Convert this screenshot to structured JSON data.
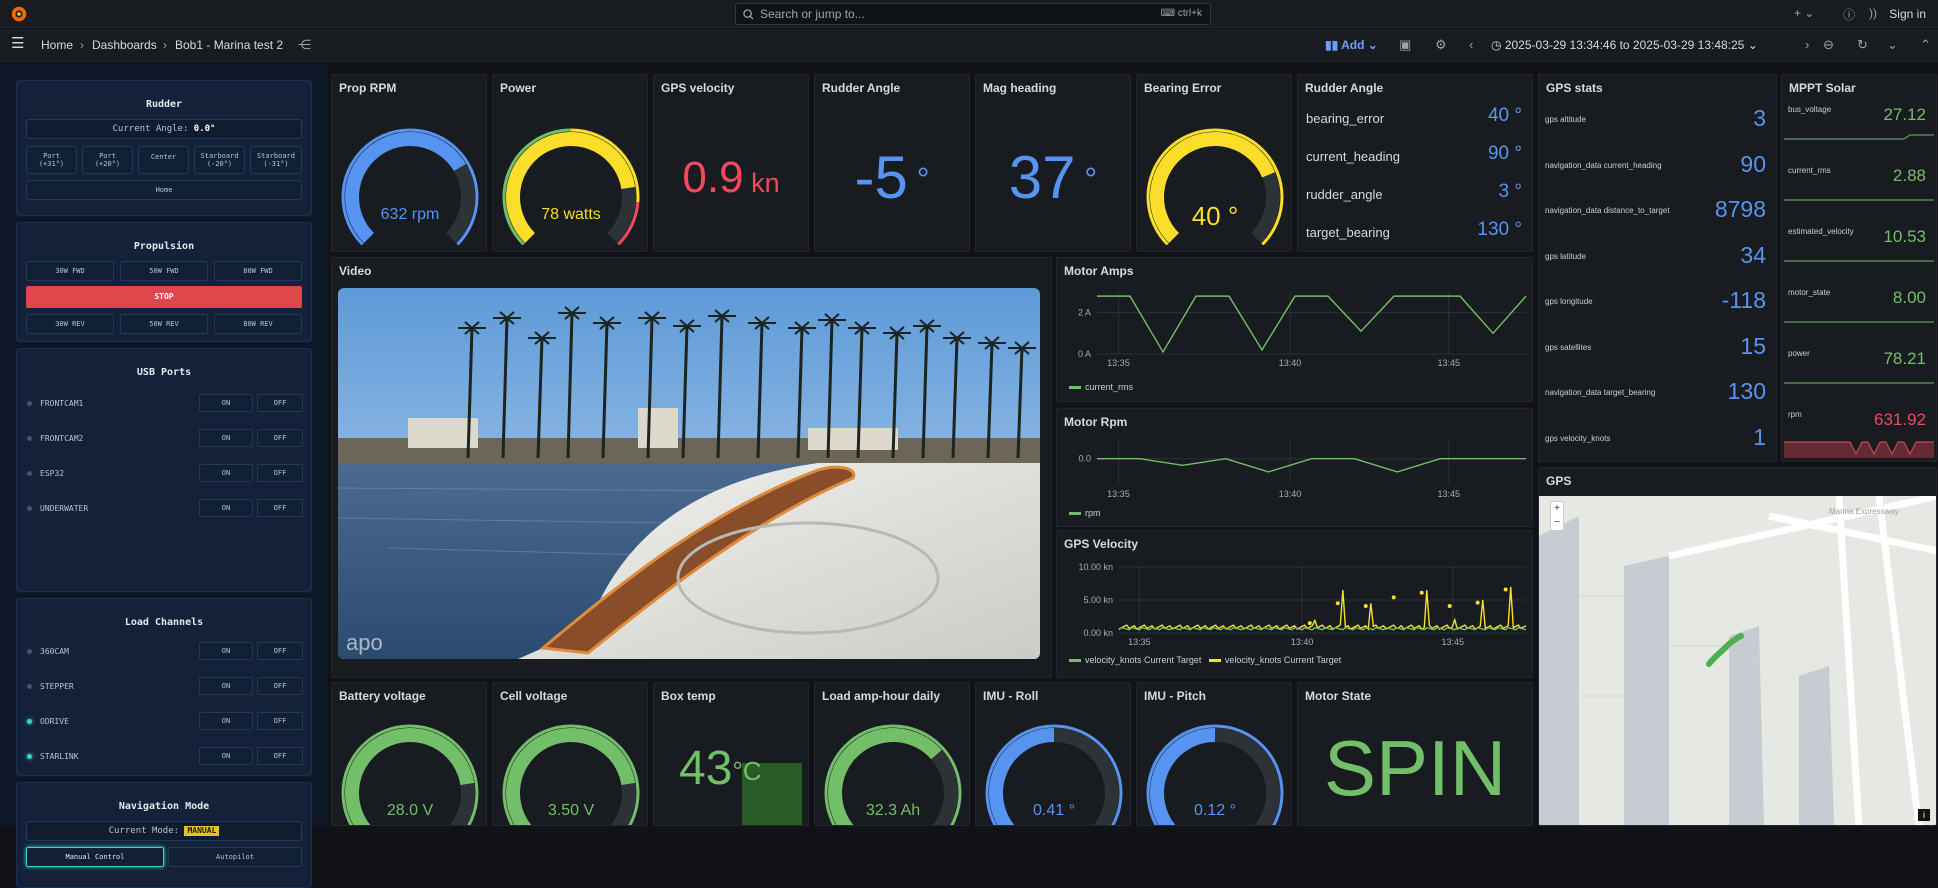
{
  "topbar": {
    "search_placeholder": "Search or jump to...",
    "search_shortcut": "ctrl+k",
    "sign_in": "Sign in"
  },
  "nav": {
    "breadcrumb": [
      "Home",
      "Dashboards",
      "Bob1 - Marina test 2"
    ],
    "add": "Add",
    "time_range": "2025-03-29 13:34:46 to 2025-03-29 13:48:25"
  },
  "sidebar": {
    "rudder": {
      "title": "Rudder",
      "angle_label": "Current Angle:",
      "angle_value": "0.0°",
      "buttons": [
        [
          "Port",
          "(+31°)"
        ],
        [
          "Port",
          "(+20°)"
        ],
        [
          "Center",
          ""
        ],
        [
          "Starboard",
          "(-20°)"
        ],
        [
          "Starboard",
          "(-31°)"
        ]
      ],
      "home": "Home"
    },
    "propulsion": {
      "title": "Propulsion",
      "fwd": [
        "30W FWD",
        "50W FWD",
        "80W FWD"
      ],
      "stop": "STOP",
      "rev": [
        "30W REV",
        "50W REV",
        "80W REV"
      ]
    },
    "usb": {
      "title": "USB Ports",
      "on": "ON",
      "off": "OFF",
      "ports": [
        {
          "name": "FRONTCAM1",
          "active": false
        },
        {
          "name": "FRONTCAM2",
          "active": false
        },
        {
          "name": "ESP32",
          "active": false
        },
        {
          "name": "UNDERWATER",
          "active": false
        }
      ]
    },
    "load": {
      "title": "Load Channels",
      "on": "ON",
      "off": "OFF",
      "channels": [
        {
          "name": "360CAM",
          "active": false
        },
        {
          "name": "STEPPER",
          "active": false
        },
        {
          "name": "ODRIVE",
          "active": true
        },
        {
          "name": "STARLINK",
          "active": true
        }
      ]
    },
    "nav_mode": {
      "title": "Navigation Mode",
      "label": "Current Mode:",
      "value": "MANUAL",
      "manual": "Manual Control",
      "auto": "Autopilot"
    }
  },
  "stats": {
    "prop_rpm": {
      "title": "Prop RPM",
      "value": "632 rpm",
      "fraction": 0.72
    },
    "power": {
      "title": "Power",
      "value": "78 watts",
      "fraction": 0.8
    },
    "gps_velocity": {
      "title": "GPS velocity",
      "value": "0.9",
      "unit": "kn"
    },
    "rudder_angle": {
      "title": "Rudder Angle",
      "value": "-5",
      "unit": "°"
    },
    "mag_heading": {
      "title": "Mag heading",
      "value": "37",
      "unit": "°"
    },
    "bearing_error": {
      "title": "Bearing Error",
      "value": "40 °",
      "fraction": 0.75
    }
  },
  "rudder_table": {
    "title": "Rudder Angle",
    "rows": [
      {
        "k": "bearing_error",
        "v": "40 °"
      },
      {
        "k": "current_heading",
        "v": "90 °"
      },
      {
        "k": "rudder_angle",
        "v": "3 °"
      },
      {
        "k": "target_bearing",
        "v": "130 °"
      }
    ]
  },
  "gps_stats": {
    "title": "GPS stats",
    "rows": [
      {
        "k": "gps altitude",
        "v": "3"
      },
      {
        "k": "navigation_data current_heading",
        "v": "90"
      },
      {
        "k": "navigation_data distance_to_target",
        "v": "8798"
      },
      {
        "k": "gps latitude",
        "v": "34"
      },
      {
        "k": "gps longitude",
        "v": "-118"
      },
      {
        "k": "gps satellites",
        "v": "15"
      },
      {
        "k": "navigation_data target_bearing",
        "v": "130"
      },
      {
        "k": "gps velocity_knots",
        "v": "1"
      }
    ]
  },
  "solar": {
    "title": "MPPT Solar",
    "rows": [
      {
        "k": "bus_voltage",
        "v": "27.12",
        "color": "#73bf69"
      },
      {
        "k": "current_rms",
        "v": "2.88",
        "color": "#73bf69"
      },
      {
        "k": "estimated_velocity",
        "v": "10.53",
        "color": "#73bf69"
      },
      {
        "k": "motor_state",
        "v": "8.00",
        "color": "#73bf69"
      },
      {
        "k": "power",
        "v": "78.21",
        "color": "#73bf69"
      },
      {
        "k": "rpm",
        "v": "631.92",
        "color": "#f2495c"
      }
    ]
  },
  "video": {
    "title": "Video",
    "watermark": "apo"
  },
  "charts": {
    "motor_amps": {
      "title": "Motor Amps",
      "yticks": [
        "2 A",
        "0 A"
      ],
      "xticks": [
        "13:35",
        "13:40",
        "13:45"
      ],
      "legend": "current_rms"
    },
    "motor_rpm": {
      "title": "Motor Rpm",
      "yticks": [
        "0.0"
      ],
      "xticks": [
        "13:35",
        "13:40",
        "13:45"
      ],
      "legend": "rpm"
    },
    "gps_velocity": {
      "title": "GPS Velocity",
      "yticks": [
        "10.00 kn",
        "5.00 kn",
        "0.00 kn"
      ],
      "xticks": [
        "13:35",
        "13:40",
        "13:45"
      ],
      "legend1": "velocity_knots Current Target",
      "legend2": "velocity_knots Current Target"
    }
  },
  "chart_data": [
    {
      "type": "line",
      "title": "Motor Amps",
      "x": [
        "13:35",
        "13:40",
        "13:45"
      ],
      "ylim": [
        0,
        3
      ],
      "series": [
        {
          "name": "current_rms",
          "values": [
            2.8,
            2.8,
            0.1,
            2.8,
            2.8,
            0.2,
            2.8,
            2.8,
            1.1,
            2.8,
            2.8,
            2.8,
            1.0,
            2.8
          ]
        }
      ]
    },
    {
      "type": "line",
      "title": "Motor Rpm",
      "x": [
        "13:35",
        "13:40",
        "13:45"
      ],
      "series": [
        {
          "name": "rpm",
          "values": [
            0,
            0,
            -0.1,
            0,
            -0.2,
            0,
            0,
            -0.2,
            0,
            0,
            0
          ]
        }
      ]
    },
    {
      "type": "line",
      "title": "GPS Velocity",
      "x": [
        "13:35",
        "13:40",
        "13:45"
      ],
      "ylim": [
        0,
        10
      ],
      "series": [
        {
          "name": "velocity_knots Current Target",
          "values": [
            0.5,
            0.9,
            0.6,
            1.0,
            0.7,
            0.9,
            2.5,
            0.8,
            3.5,
            1.0,
            5.0,
            0.9
          ]
        }
      ]
    }
  ],
  "bottom": {
    "battery": {
      "title": "Battery voltage",
      "value": "28.0 V",
      "fraction": 0.8
    },
    "cell": {
      "title": "Cell voltage",
      "value": "3.50 V",
      "fraction": 0.8
    },
    "box_temp": {
      "title": "Box temp",
      "value": "43",
      "unit": "°C"
    },
    "load_ah": {
      "title": "Load amp-hour daily",
      "value": "32.3 Ah",
      "fraction": 0.68
    },
    "imu_roll": {
      "title": "IMU - Roll",
      "value": "0.41 °",
      "fraction": 0.5
    },
    "imu_pitch": {
      "title": "IMU - Pitch",
      "value": "0.12 °",
      "fraction": 0.5
    },
    "motor_state": {
      "title": "Motor State",
      "value": "SPIN"
    }
  },
  "map": {
    "title": "GPS",
    "zoom_in": "+",
    "zoom_out": "−",
    "info": "i",
    "street": "Marina Expressway"
  }
}
